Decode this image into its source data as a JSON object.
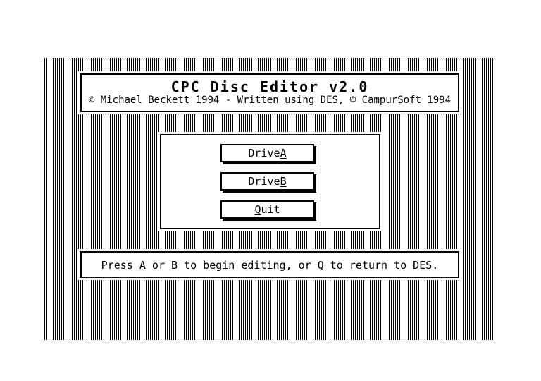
{
  "app": {
    "title": "CPC Disc Editor v2.0",
    "copyright": "© Michael Beckett 1994 - Written using DES, © CampurSoft 1994"
  },
  "menu": {
    "items": [
      {
        "label_prefix": "Drive ",
        "hotkey": "A",
        "label_suffix": ""
      },
      {
        "label_prefix": "Drive ",
        "hotkey": "B",
        "label_suffix": ""
      },
      {
        "label_prefix": "",
        "hotkey": "Q",
        "label_suffix": "uit"
      }
    ]
  },
  "status": {
    "message": "Press A or B to begin editing, or Q to return to DES."
  }
}
